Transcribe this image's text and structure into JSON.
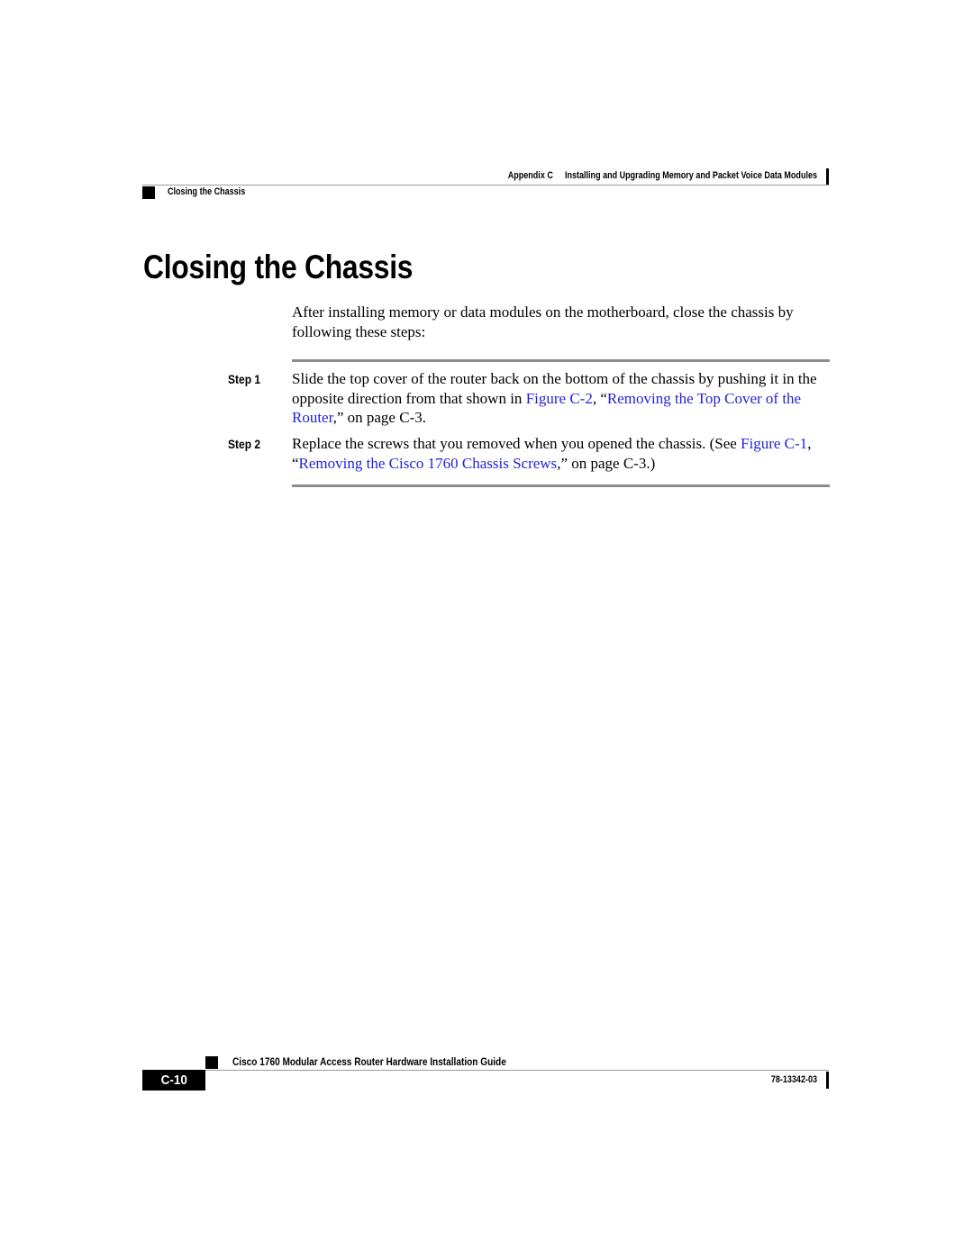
{
  "header": {
    "chapter": "Appendix C",
    "chapter_title": "Installing and Upgrading Memory and Packet Voice Data Modules",
    "section": "Closing the Chassis"
  },
  "title": "Closing the Chassis",
  "intro": "After installing memory or data modules on the motherboard, close the chassis by following these steps:",
  "link_color": "#2222dd",
  "steps": [
    {
      "label": "Step 1",
      "text_before": "Slide the top cover of the router back on the bottom of the chassis by pushing it in the opposite direction from that shown in ",
      "figure_link": "Figure C-2",
      "sep": ", “",
      "title_link": "Removing the Top Cover of the Router",
      "text_after": ",” on page C-3."
    },
    {
      "label": "Step 2",
      "text_before": "Replace the screws that you removed when you opened the chassis. (See ",
      "figure_link": "Figure C-1",
      "sep": ", “",
      "title_link": "Removing the Cisco 1760 Chassis Screws",
      "text_after": ",” on page C-3.)"
    }
  ],
  "footer": {
    "book_title": "Cisco 1760 Modular Access Router Hardware Installation Guide",
    "page_number": "C-10",
    "doc_number": "78-13342-03"
  }
}
